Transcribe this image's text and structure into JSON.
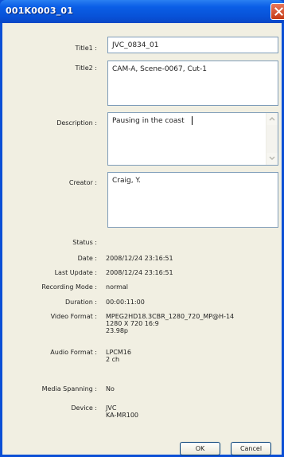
{
  "window": {
    "title": "001K0003_01"
  },
  "fields": {
    "title1": {
      "label": "Title1 :",
      "value": "JVC_0834_01"
    },
    "title2": {
      "label": "Title2 :",
      "value": "CAM-A, Scene-0067, Cut-1"
    },
    "description": {
      "label": "Description :",
      "value": "Pausing in the coast"
    },
    "creator": {
      "label": "Creator :",
      "value": "Craig, Y."
    }
  },
  "info": {
    "status": {
      "label": "Status :",
      "value": ""
    },
    "date": {
      "label": "Date :",
      "value": "2008/12/24 23:16:51"
    },
    "last_update": {
      "label": "Last Update :",
      "value": "2008/12/24 23:16:51"
    },
    "recording_mode": {
      "label": "Recording Mode :",
      "value": "normal"
    },
    "duration": {
      "label": "Duration :",
      "value": "00:00:11:00"
    },
    "video_format": {
      "label": "Video Format :",
      "lines": [
        "MPEG2HD18.3CBR_1280_720_MP@H-14",
        "1280 X 720 16:9",
        "23.98p"
      ]
    },
    "audio_format": {
      "label": "Audio Format :",
      "lines": [
        "LPCM16",
        "2 ch"
      ]
    },
    "media_spanning": {
      "label": "Media Spanning :",
      "value": "No"
    },
    "device": {
      "label": "Device :",
      "lines": [
        "JVC",
        "KA-MR100"
      ]
    }
  },
  "buttons": {
    "ok": "OK",
    "cancel": "Cancel"
  },
  "colors": {
    "titlebar": "#0a5ee6",
    "dialog_bg": "#f1efe2",
    "field_border": "#7f9db9",
    "close_button": "#c53a14"
  },
  "icons": {
    "close": "close-icon",
    "scroll_up": "chevron-up-icon",
    "scroll_down": "chevron-down-icon"
  }
}
